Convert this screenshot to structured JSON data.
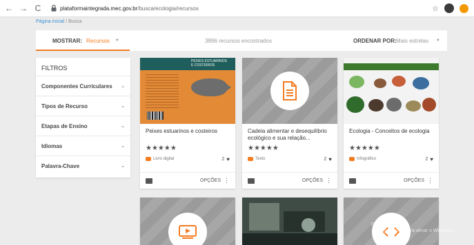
{
  "browser": {
    "url_domain": "plataformaintegrada.mec.gov.br",
    "url_path": "/busca/ecologia/recursos"
  },
  "breadcrumb": {
    "home": "Página inicial",
    "separator": "/",
    "current": "Busca"
  },
  "toolbar": {
    "mostrar_label": "MOSTRAR:",
    "mostrar_value": "Recursos",
    "count_text": "3896 recursos encontrados",
    "ordenar_label": "ORDENAR POR:",
    "ordenar_value": "Mais estrelas"
  },
  "filters": {
    "title": "FILTROS",
    "items": [
      {
        "label": "Componentes Curriculares"
      },
      {
        "label": "Tipos de Recurso"
      },
      {
        "label": "Etapas de Ensino"
      },
      {
        "label": "Idiomas"
      },
      {
        "label": "Palavra-Chave"
      }
    ]
  },
  "book_cover": {
    "title_line1": "PEIXES ESTUARINOS",
    "title_line2": "E COSTEIROS"
  },
  "cards": [
    {
      "title": "Peixes estuarinos e costeiros",
      "stars": "★★★★★",
      "type": "Livro digital",
      "likes": "2",
      "options": "OPÇÕES"
    },
    {
      "title": "Cadeia alimentar e desequilíbrio ecológico e sua relação...",
      "stars": "★★★★★",
      "type": "Texto",
      "likes": "2",
      "options": "OPÇÕES"
    },
    {
      "title": "Ecologia - Conceitos de ecologia",
      "stars": "★★★★★",
      "type": "Infográfico",
      "likes": "2",
      "options": "OPÇÕES"
    }
  ],
  "watermark": {
    "line1": "o Windows",
    "line2": "Configurações para ativar o Windows."
  },
  "colors": {
    "accent": "#f47b20",
    "link": "#3d8fd1"
  },
  "icons": [
    "back-arrow-icon",
    "forward-arrow-icon",
    "reload-icon",
    "lock-icon",
    "bookmark-star-icon",
    "document-icon",
    "video-play-icon",
    "heart-icon",
    "add-to-collection-icon",
    "chevron-down-icon"
  ]
}
